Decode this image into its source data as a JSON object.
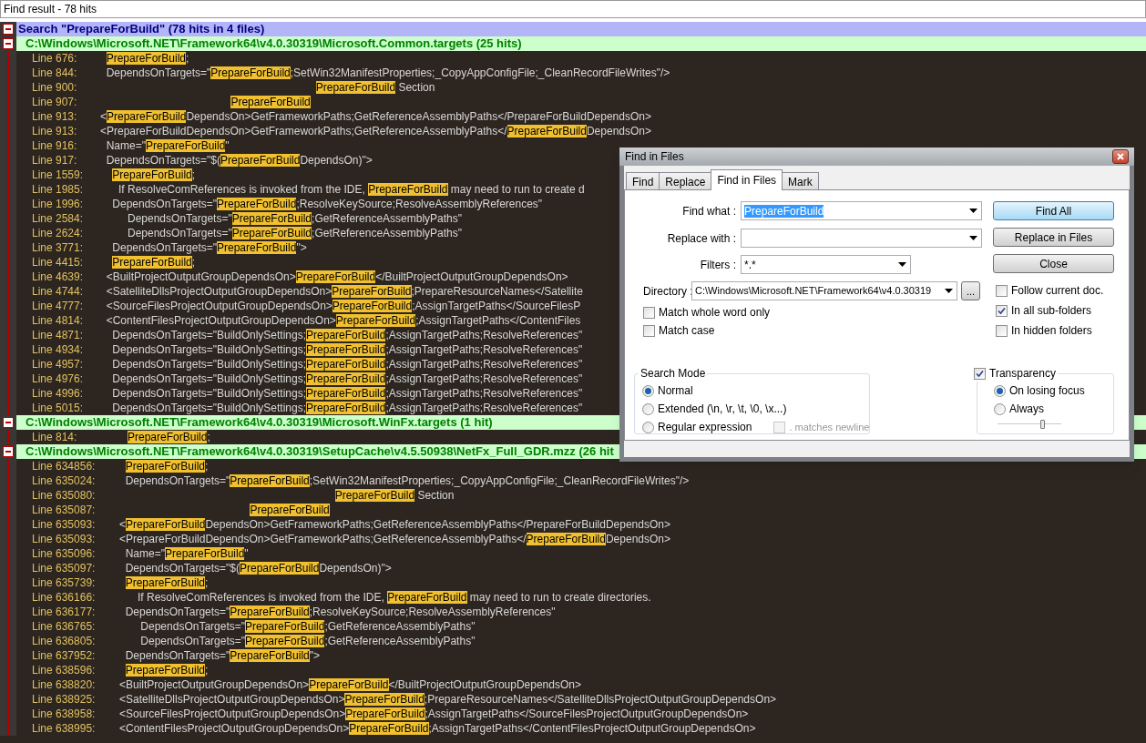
{
  "panel_title": "Find result - 78 hits",
  "search": {
    "title": "Search \"PrepareForBuild\" (78 hits in 4 files)",
    "expanded": true,
    "files": [
      {
        "path": "C:\\Windows\\Microsoft.NET\\Framework64\\v4.0.30319\\Microsoft.Common.targets (25 hits)",
        "expanded": true,
        "hits": [
          {
            "label": "Line 676:",
            "hit": "     PrepareForBuild",
            "after": ";"
          },
          {
            "label": "Line 844:",
            "before": "     DependsOnTargets=\"",
            "hit": "PrepareForBuild",
            "after": ";SetWin32ManifestProperties;_CopyAppConfigFile;_CleanRecordFileWrites\"/>"
          },
          {
            "label": "Line 900:",
            "hit": "                                                                          PrepareForBuild",
            "after": " Section"
          },
          {
            "label": "Line 907:",
            "hit": "                                              PrepareForBuild"
          },
          {
            "label": "Line 913:",
            "before": "   <",
            "hit": "PrepareForBuild",
            "after": "DependsOn>GetFrameworkPaths;GetReferenceAssemblyPaths</PrepareForBuildDependsOn>"
          },
          {
            "label": "Line 913:",
            "before": "   <PrepareForBuildDependsOn>GetFrameworkPaths;GetReferenceAssemblyPaths</",
            "hit": "PrepareForBuild",
            "after": "DependsOn>"
          },
          {
            "label": "Line 916:",
            "before": "     Name=\"",
            "hit": "PrepareForBuild",
            "after": "\""
          },
          {
            "label": "Line 917:",
            "before": "     DependsOnTargets=\"$(",
            "hit": "PrepareForBuild",
            "after": "DependsOn)\">"
          },
          {
            "label": "Line 1559:",
            "hit": "       PrepareForBuild",
            "after": ";"
          },
          {
            "label": "Line 1985:",
            "before": "         If ResolveComReferences is invoked from the IDE, ",
            "hit": "PrepareForBuild",
            "after": " may need to run to create d"
          },
          {
            "label": "Line 1996:",
            "before": "       DependsOnTargets=\"",
            "hit": "PrepareForBuild",
            "after": ";ResolveKeySource;ResolveAssemblyReferences\""
          },
          {
            "label": "Line 2584:",
            "before": "            DependsOnTargets=\"",
            "hit": "PrepareForBuild",
            "after": ";GetReferenceAssemblyPaths\""
          },
          {
            "label": "Line 2624:",
            "before": "            DependsOnTargets=\"",
            "hit": "PrepareForBuild",
            "after": ";GetReferenceAssemblyPaths\""
          },
          {
            "label": "Line 3771:",
            "before": "       DependsOnTargets=\"",
            "hit": "PrepareForBuild",
            "after": "\">"
          },
          {
            "label": "Line 4415:",
            "hit": "       PrepareForBuild",
            "after": ";"
          },
          {
            "label": "Line 4639:",
            "before": "     <BuiltProjectOutputGroupDependsOn>",
            "hit": "PrepareForBuild",
            "after": "</BuiltProjectOutputGroupDependsOn>"
          },
          {
            "label": "Line 4744:",
            "before": "     <SatelliteDllsProjectOutputGroupDependsOn>",
            "hit": "PrepareForBuild",
            "after": ";PrepareResourceNames</Satellite"
          },
          {
            "label": "Line 4777:",
            "before": "     <SourceFilesProjectOutputGroupDependsOn>",
            "hit": "PrepareForBuild",
            "after": ";AssignTargetPaths</SourceFilesP"
          },
          {
            "label": "Line 4814:",
            "before": "     <ContentFilesProjectOutputGroupDependsOn>",
            "hit": "PrepareForBuild",
            "after": ";AssignTargetPaths</ContentFiles"
          },
          {
            "label": "Line 4871:",
            "before": "       DependsOnTargets=\"BuildOnlySettings;",
            "hit": "PrepareForBuild",
            "after": ";AssignTargetPaths;ResolveReferences\""
          },
          {
            "label": "Line 4934:",
            "before": "       DependsOnTargets=\"BuildOnlySettings;",
            "hit": "PrepareForBuild",
            "after": ";AssignTargetPaths;ResolveReferences\""
          },
          {
            "label": "Line 4957:",
            "before": "       DependsOnTargets=\"BuildOnlySettings;",
            "hit": "PrepareForBuild",
            "after": ";AssignTargetPaths;ResolveReferences\""
          },
          {
            "label": "Line 4976:",
            "before": "       DependsOnTargets=\"BuildOnlySettings;",
            "hit": "PrepareForBuild",
            "after": ";AssignTargetPaths;ResolveReferences\""
          },
          {
            "label": "Line 4996:",
            "before": "       DependsOnTargets=\"BuildOnlySettings;",
            "hit": "PrepareForBuild",
            "after": ";AssignTargetPaths;ResolveReferences\""
          },
          {
            "label": "Line 5015:",
            "before": "       DependsOnTargets=\"BuildOnlySettings;",
            "hit": "PrepareForBuild",
            "after": ";AssignTargetPaths;ResolveReferences\""
          }
        ]
      },
      {
        "path": "C:\\Windows\\Microsoft.NET\\Framework64\\v4.0.30319\\Microsoft.WinFx.targets (1 hit)",
        "expanded": true,
        "hits": [
          {
            "label": "Line 814:",
            "hit": "            PrepareForBuild",
            "after": ";"
          }
        ]
      },
      {
        "path": "C:\\Windows\\Microsoft.NET\\Framework64\\v4.0.30319\\SetupCache\\v4.5.50938\\NetFx_Full_GDR.mzz (26 hit",
        "expanded": true,
        "hits": [
          {
            "label": "Line 634856:",
            "hit": "     PrepareForBuild",
            "after": ";"
          },
          {
            "label": "Line 635024:",
            "before": "     DependsOnTargets=\"",
            "hit": "PrepareForBuild",
            "after": ";SetWin32ManifestProperties;_CopyAppConfigFile;_CleanRecordFileWrites\"/>"
          },
          {
            "label": "Line 635080:",
            "hit": "                                                                          PrepareForBuild",
            "after": " Section"
          },
          {
            "label": "Line 635087:",
            "hit": "                                              PrepareForBuild"
          },
          {
            "label": "Line 635093:",
            "before": "   <",
            "hit": "PrepareForBuild",
            "after": "DependsOn>GetFrameworkPaths;GetReferenceAssemblyPaths</PrepareForBuildDependsOn>"
          },
          {
            "label": "Line 635093:",
            "before": "   <PrepareForBuildDependsOn>GetFrameworkPaths;GetReferenceAssemblyPaths</",
            "hit": "PrepareForBuild",
            "after": "DependsOn>"
          },
          {
            "label": "Line 635096:",
            "before": "     Name=\"",
            "hit": "PrepareForBuild",
            "after": "\""
          },
          {
            "label": "Line 635097:",
            "before": "     DependsOnTargets=\"$(",
            "hit": "PrepareForBuild",
            "after": "DependsOn)\">"
          },
          {
            "label": "Line 635739:",
            "hit": "     PrepareForBuild",
            "after": ";"
          },
          {
            "label": "Line 636166:",
            "before": "         If ResolveComReferences is invoked from the IDE, ",
            "hit": "PrepareForBuild",
            "after": " may need to run to create directories."
          },
          {
            "label": "Line 636177:",
            "before": "     DependsOnTargets=\"",
            "hit": "PrepareForBuild",
            "after": ";ResolveKeySource;ResolveAssemblyReferences\""
          },
          {
            "label": "Line 636765:",
            "before": "          DependsOnTargets=\"",
            "hit": "PrepareForBuild",
            "after": ";GetReferenceAssemblyPaths\""
          },
          {
            "label": "Line 636805:",
            "before": "          DependsOnTargets=\"",
            "hit": "PrepareForBuild",
            "after": ";GetReferenceAssemblyPaths\""
          },
          {
            "label": "Line 637952:",
            "before": "     DependsOnTargets=\"",
            "hit": "PrepareForBuild",
            "after": "\">"
          },
          {
            "label": "Line 638596:",
            "hit": "     PrepareForBuild",
            "after": ";"
          },
          {
            "label": "Line 638820:",
            "before": "   <BuiltProjectOutputGroupDependsOn>",
            "hit": "PrepareForBuild",
            "after": "</BuiltProjectOutputGroupDependsOn>"
          },
          {
            "label": "Line 638925:",
            "before": "   <SatelliteDllsProjectOutputGroupDependsOn>",
            "hit": "PrepareForBuild",
            "after": ";PrepareResourceNames</SatelliteDllsProjectOutputGroupDependsOn>"
          },
          {
            "label": "Line 638958:",
            "before": "   <SourceFilesProjectOutputGroupDependsOn>",
            "hit": "PrepareForBuild",
            "after": ";AssignTargetPaths</SourceFilesProjectOutputGroupDependsOn>"
          },
          {
            "label": "Line 638995:",
            "before": "   <ContentFilesProjectOutputGroupDependsOn>",
            "hit": "PrepareForBuild",
            "after": ";AssignTargetPaths</ContentFilesProjectOutputGroupDependsOn>"
          }
        ]
      }
    ]
  },
  "dialog": {
    "title": "Find in Files",
    "tabs": [
      {
        "label": "Find",
        "selected": false
      },
      {
        "label": "Replace",
        "selected": false
      },
      {
        "label": "Find in Files",
        "selected": true
      },
      {
        "label": "Mark",
        "selected": false
      }
    ],
    "find_what": {
      "label": "Find what :",
      "value": "PrepareForBuild"
    },
    "replace_with": {
      "label": "Replace with :"
    },
    "filters": {
      "label": "Filters :",
      "value": "*.*"
    },
    "directory": {
      "label": "Directory :",
      "value": "C:\\Windows\\Microsoft.NET\\Framework64\\v4.0.30319",
      "browse": "..."
    },
    "options": [
      {
        "label": "Match whole word only",
        "checked": false
      },
      {
        "label": "Match case",
        "checked": false
      }
    ],
    "buttons": [
      {
        "label": "Find All",
        "default": true
      },
      {
        "label": "Replace in Files",
        "default": false
      },
      {
        "label": "Close",
        "default": false
      }
    ],
    "folder_options": [
      {
        "label": "Follow current doc.",
        "checked": false
      },
      {
        "label": "In all sub-folders",
        "checked": true
      },
      {
        "label": "In hidden folders",
        "checked": false
      }
    ],
    "search_mode": {
      "title": "Search Mode",
      "modes": [
        {
          "label": "Normal",
          "selected": true
        },
        {
          "label": "Extended (\\n, \\r, \\t, \\0, \\x...)",
          "selected": false
        },
        {
          "label": "Regular expression",
          "selected": false
        }
      ],
      "dot_newline": {
        "label": ". matches newline",
        "checked": false,
        "disabled": true
      }
    },
    "transparency": {
      "label": "Transparency",
      "checked": true,
      "modes": [
        {
          "label": "On losing focus",
          "selected": true
        },
        {
          "label": "Always",
          "selected": false
        }
      ],
      "level": 0.7
    }
  }
}
